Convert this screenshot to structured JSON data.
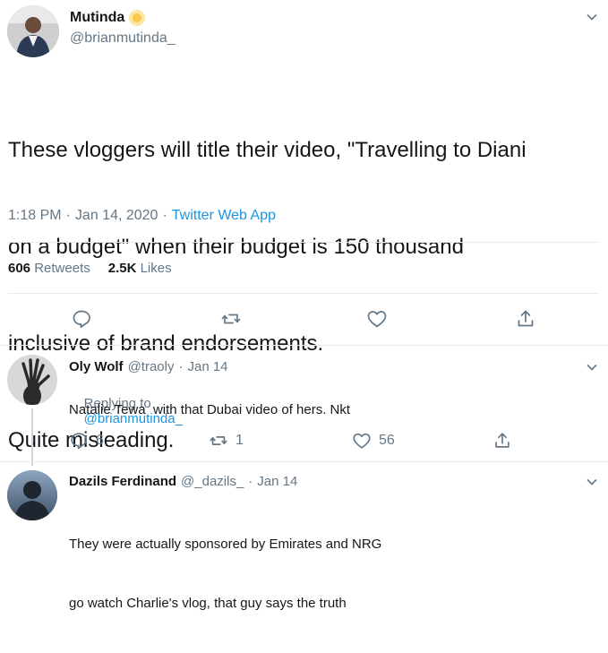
{
  "tweet": {
    "display_name": "Mutinda",
    "username": "@brianmutinda_",
    "text_lines": [
      "These vloggers will title their video, \"Travelling to Diani",
      "on a budget\" when their budget is 150 thousand",
      "inclusive of brand endorsements.",
      "Quite misleading."
    ],
    "time": "1:18 PM",
    "date": "Jan 14, 2020",
    "source": "Twitter Web App",
    "separator": "·",
    "retweets_count": "606",
    "retweets_label": "Retweets",
    "likes_count": "2.5K",
    "likes_label": "Likes",
    "badge_icon": "sun-emoji-icon"
  },
  "replies": [
    {
      "display_name": "Oly Wolf",
      "username": "@traoly",
      "date": "Jan 14",
      "replying_to_label": "Replying to",
      "replying_to_user": "@brianmutinda_",
      "text_lines": [
        "Natalie Tewa  with that Dubai video of hers. Nkt"
      ],
      "reply_count": "6",
      "retweet_count": "1",
      "like_count": "56"
    },
    {
      "display_name": "Dazils Ferdinand",
      "username": "@_dazils_",
      "date": "Jan 14",
      "text_lines": [
        "They were actually sponsored by Emirates and NRG",
        "go watch Charlie's vlog, that guy says the truth"
      ]
    }
  ],
  "colors": {
    "accent": "#1b95e0",
    "muted": "#657786",
    "divider": "#e6ecf0"
  }
}
